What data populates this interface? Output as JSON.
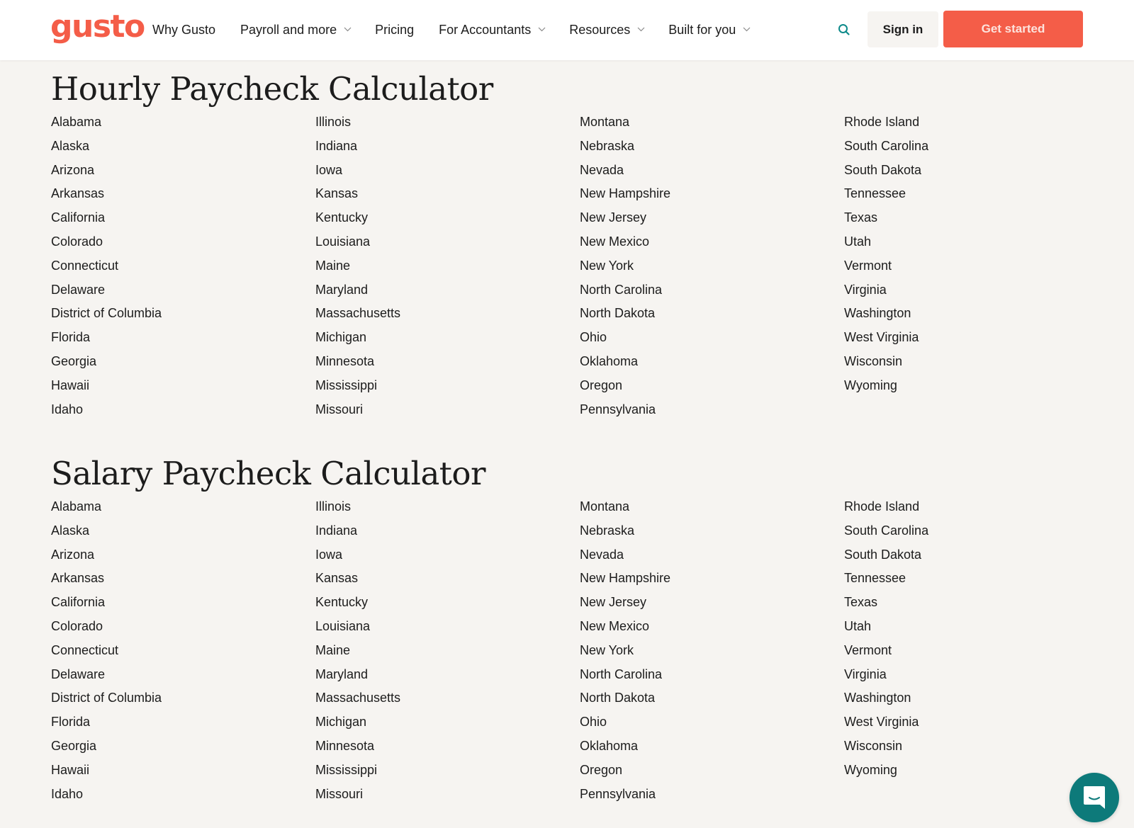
{
  "brand": {
    "logo_text": "gusto",
    "accent_color": "#f45d48",
    "chat_color": "#0d7a7a"
  },
  "header": {
    "nav": [
      {
        "label": "Why Gusto",
        "has_dropdown": false
      },
      {
        "label": "Payroll and more",
        "has_dropdown": true
      },
      {
        "label": "Pricing",
        "has_dropdown": false
      },
      {
        "label": "For Accountants",
        "has_dropdown": true
      },
      {
        "label": "Resources",
        "has_dropdown": true
      },
      {
        "label": "Built for you",
        "has_dropdown": true
      }
    ],
    "search_icon": "search-icon",
    "sign_in_label": "Sign in",
    "get_started_label": "Get started"
  },
  "sections": [
    {
      "title": "Hourly Paycheck Calculator",
      "columns": [
        [
          "Alabama",
          "Alaska",
          "Arizona",
          "Arkansas",
          "California",
          "Colorado",
          "Connecticut",
          "Delaware",
          "District of Columbia",
          "Florida",
          "Georgia",
          "Hawaii",
          "Idaho"
        ],
        [
          "Illinois",
          "Indiana",
          "Iowa",
          "Kansas",
          "Kentucky",
          "Louisiana",
          "Maine",
          "Maryland",
          "Massachusetts",
          "Michigan",
          "Minnesota",
          "Mississippi",
          "Missouri"
        ],
        [
          "Montana",
          "Nebraska",
          "Nevada",
          "New Hampshire",
          "New Jersey",
          "New Mexico",
          "New York",
          "North Carolina",
          "North Dakota",
          "Ohio",
          "Oklahoma",
          "Oregon",
          "Pennsylvania"
        ],
        [
          "Rhode Island",
          "South Carolina",
          "South Dakota",
          "Tennessee",
          "Texas",
          "Utah",
          "Vermont",
          "Virginia",
          "Washington",
          "West Virginia",
          "Wisconsin",
          "Wyoming"
        ]
      ]
    },
    {
      "title": "Salary Paycheck Calculator",
      "columns": [
        [
          "Alabama",
          "Alaska",
          "Arizona",
          "Arkansas",
          "California",
          "Colorado",
          "Connecticut",
          "Delaware",
          "District of Columbia",
          "Florida",
          "Georgia",
          "Hawaii",
          "Idaho"
        ],
        [
          "Illinois",
          "Indiana",
          "Iowa",
          "Kansas",
          "Kentucky",
          "Louisiana",
          "Maine",
          "Maryland",
          "Massachusetts",
          "Michigan",
          "Minnesota",
          "Mississippi",
          "Missouri"
        ],
        [
          "Montana",
          "Nebraska",
          "Nevada",
          "New Hampshire",
          "New Jersey",
          "New Mexico",
          "New York",
          "North Carolina",
          "North Dakota",
          "Ohio",
          "Oklahoma",
          "Oregon",
          "Pennsylvania"
        ],
        [
          "Rhode Island",
          "South Carolina",
          "South Dakota",
          "Tennessee",
          "Texas",
          "Utah",
          "Vermont",
          "Virginia",
          "Washington",
          "West Virginia",
          "Wisconsin",
          "Wyoming"
        ]
      ]
    }
  ],
  "chat_widget": {
    "icon": "chat-icon"
  }
}
